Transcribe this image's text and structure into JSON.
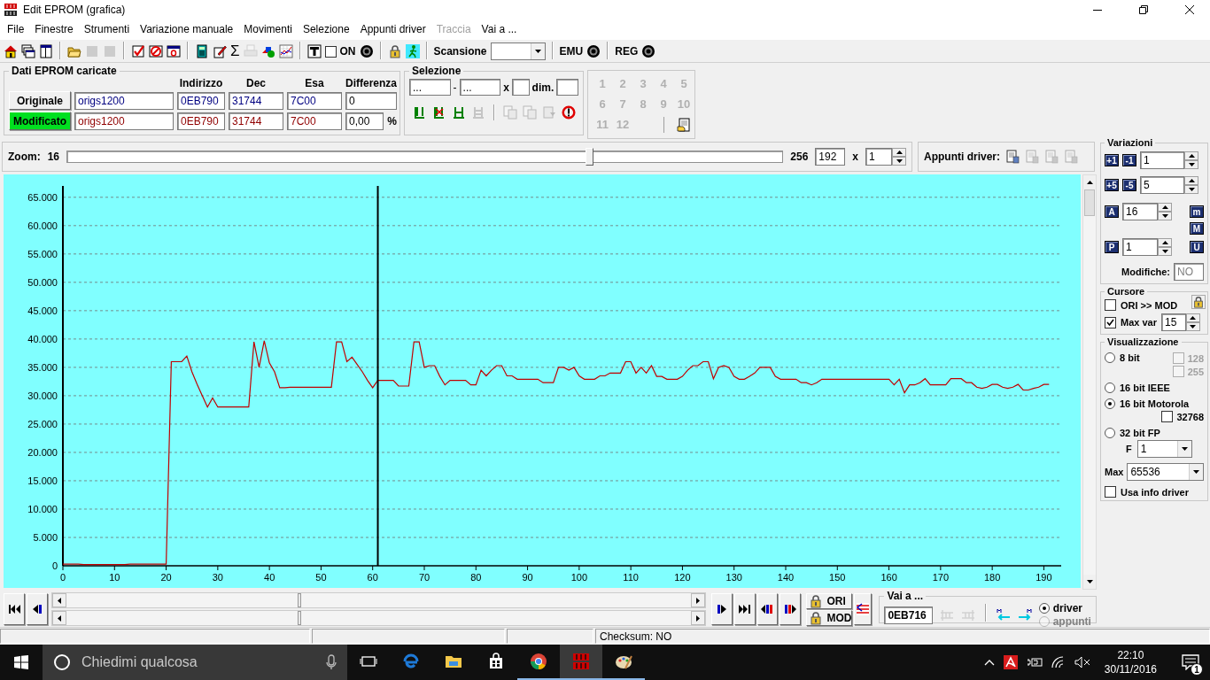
{
  "window": {
    "title": "Edit EPROM (grafica)"
  },
  "menu": [
    {
      "label": "File",
      "disabled": false
    },
    {
      "label": "Finestre",
      "disabled": false
    },
    {
      "label": "Strumenti",
      "disabled": false
    },
    {
      "label": "Variazione manuale",
      "disabled": false
    },
    {
      "label": "Movimenti",
      "disabled": false
    },
    {
      "label": "Selezione",
      "disabled": false
    },
    {
      "label": "Appunti driver",
      "disabled": false
    },
    {
      "label": "Traccia",
      "disabled": true
    },
    {
      "label": "Vai a ...",
      "disabled": false
    }
  ],
  "toolbar": [
    {
      "kind": "home",
      "disabled": false
    },
    {
      "kind": "windows",
      "disabled": false
    },
    {
      "kind": "panel",
      "disabled": false
    },
    {
      "kind": "sep"
    },
    {
      "kind": "folder",
      "disabled": false
    },
    {
      "kind": "square",
      "disabled": true
    },
    {
      "kind": "square",
      "disabled": true
    },
    {
      "kind": "sep"
    },
    {
      "kind": "check",
      "disabled": false
    },
    {
      "kind": "forbid",
      "disabled": false
    },
    {
      "kind": "zerowin",
      "disabled": false
    },
    {
      "kind": "sep"
    },
    {
      "kind": "calc",
      "disabled": false
    },
    {
      "kind": "edit",
      "disabled": false
    },
    {
      "kind": "glyph",
      "label": "Σ",
      "disabled": false
    },
    {
      "kind": "printer",
      "disabled": true
    },
    {
      "kind": "shapes",
      "disabled": false
    },
    {
      "kind": "graph",
      "disabled": false
    },
    {
      "kind": "sep"
    },
    {
      "kind": "tbox",
      "disabled": false
    },
    {
      "kind": "checkbox",
      "label": "ON",
      "checked": false
    },
    {
      "kind": "target",
      "disabled": false
    },
    {
      "kind": "sep"
    },
    {
      "kind": "lock",
      "disabled": false
    },
    {
      "kind": "runner",
      "disabled": false
    },
    {
      "kind": "sep"
    },
    {
      "kind": "combo",
      "label": "Scansione"
    },
    {
      "kind": "sep"
    },
    {
      "kind": "led",
      "label": "EMU"
    },
    {
      "kind": "sep"
    },
    {
      "kind": "led",
      "label": "REG"
    }
  ],
  "eprom": {
    "title": "Dati EPROM caricate",
    "columns": [
      "Indirizzo",
      "Dec",
      "Esa",
      "Differenza"
    ],
    "rows": [
      {
        "label": "Originale",
        "highlighted": false,
        "color": "#000080",
        "file": "origs1200",
        "address": "0EB790",
        "dec": "31744",
        "hex": "7C00",
        "difference": "0"
      },
      {
        "label": "Modificato",
        "highlighted": true,
        "color": "#900000",
        "file": "origs1200",
        "address": "0EB790",
        "dec": "31744",
        "hex": "7C00",
        "difference": "0,00",
        "unit": "%"
      }
    ]
  },
  "selection": {
    "title": "Selezione",
    "from": "...",
    "separator": "-",
    "to": "...",
    "times": "x",
    "dim_label": "dim.",
    "tools": [
      {
        "kind": "mstart",
        "disabled": false
      },
      {
        "kind": "mclear",
        "disabled": false
      },
      {
        "kind": "mboth",
        "disabled": false
      },
      {
        "kind": "mnone",
        "disabled": true
      },
      {
        "kind": "copy",
        "disabled": true
      },
      {
        "kind": "copy",
        "disabled": true
      },
      {
        "kind": "paste",
        "disabled": true
      },
      {
        "kind": "reset",
        "disabled": false
      }
    ]
  },
  "keys": {
    "buttons": [
      {
        "label": "1",
        "disabled": true
      },
      {
        "label": "2",
        "disabled": true
      },
      {
        "label": "3",
        "disabled": true
      },
      {
        "label": "4",
        "disabled": true
      },
      {
        "label": "5",
        "disabled": true
      },
      {
        "label": "6",
        "disabled": true
      },
      {
        "label": "7",
        "disabled": true
      },
      {
        "label": "8",
        "disabled": true
      },
      {
        "label": "9",
        "disabled": true
      },
      {
        "label": "10",
        "disabled": true
      },
      {
        "label": "11",
        "disabled": true
      },
      {
        "label": "12",
        "disabled": true
      }
    ],
    "clipboard": {
      "disabled": false
    }
  },
  "zoom": {
    "label": "Zoom:",
    "min": "16",
    "level": 0.733,
    "max": "256",
    "value": "192",
    "times": "x",
    "step": "1"
  },
  "driver_clipboard": {
    "label": "Appunti driver:",
    "tools": [
      {
        "disabled": false
      },
      {
        "disabled": true
      },
      {
        "disabled": true
      },
      {
        "disabled": true
      }
    ]
  },
  "chart": {
    "chart_data": {
      "type": "line",
      "xlim": [
        0,
        192.5
      ],
      "ylim": [
        0,
        67000
      ],
      "xticks": [
        0,
        10,
        20,
        30,
        40,
        50,
        60,
        70,
        80,
        90,
        100,
        110,
        120,
        130,
        140,
        150,
        160,
        170,
        180,
        190
      ],
      "yticks": [
        {
          "value": 0,
          "label": "0"
        },
        {
          "value": 5000,
          "label": "5.000"
        },
        {
          "value": 10000,
          "label": "10.000"
        },
        {
          "value": 15000,
          "label": "15.000"
        },
        {
          "value": 20000,
          "label": "20.000"
        },
        {
          "value": 25000,
          "label": "25.000"
        },
        {
          "value": 30000,
          "label": "30.000"
        },
        {
          "value": 35000,
          "label": "35.000"
        },
        {
          "value": 40000,
          "label": "40.000"
        },
        {
          "value": 45000,
          "label": "45.000"
        },
        {
          "value": 50000,
          "label": "50.000"
        },
        {
          "value": 55000,
          "label": "55.000"
        },
        {
          "value": 60000,
          "label": "60.000"
        },
        {
          "value": 65000,
          "label": "65.000"
        }
      ],
      "x": [
        0,
        1,
        2,
        3,
        4,
        5,
        6,
        7,
        8,
        9,
        10,
        11,
        12,
        13,
        14,
        15,
        16,
        17,
        18,
        19,
        20,
        21,
        22,
        23,
        24,
        25,
        26,
        27,
        28,
        29,
        30,
        31,
        32,
        33,
        34,
        35,
        36,
        37,
        38,
        39,
        40,
        41,
        42,
        43,
        44,
        45,
        46,
        47,
        48,
        49,
        50,
        51,
        52,
        53,
        54,
        55,
        56,
        57,
        58,
        59,
        60,
        61,
        62,
        63,
        64,
        65,
        66,
        67,
        68,
        69,
        70,
        71,
        72,
        73,
        74,
        75,
        76,
        77,
        78,
        79,
        80,
        81,
        82,
        83,
        84,
        85,
        86,
        87,
        88,
        89,
        90,
        91,
        92,
        93,
        94,
        95,
        96,
        97,
        98,
        99,
        100,
        101,
        102,
        103,
        104,
        105,
        106,
        107,
        108,
        109,
        110,
        111,
        112,
        113,
        114,
        115,
        116,
        117,
        118,
        119,
        120,
        121,
        122,
        123,
        124,
        125,
        126,
        127,
        128,
        129,
        130,
        131,
        132,
        133,
        134,
        135,
        136,
        137,
        138,
        139,
        140,
        141,
        142,
        143,
        144,
        145,
        146,
        147,
        148,
        149,
        150,
        151,
        152,
        153,
        154,
        155,
        156,
        157,
        158,
        159,
        160,
        161,
        162,
        163,
        164,
        165,
        166,
        167,
        168,
        169,
        170,
        171,
        172,
        173,
        174,
        175,
        176,
        177,
        178,
        179,
        180,
        181,
        182,
        183,
        184,
        185,
        186,
        187,
        188,
        189,
        190,
        191
      ],
      "series": [
        {
          "color": "#c00000",
          "values": [
            300,
            300,
            300,
            300,
            200,
            200,
            200,
            200,
            200,
            200,
            200,
            200,
            200,
            300,
            300,
            300,
            300,
            300,
            300,
            300,
            300,
            36000,
            36000,
            36000,
            37000,
            34200,
            32000,
            30000,
            28000,
            29600,
            28000,
            28000,
            28000,
            28000,
            28000,
            28000,
            28000,
            39500,
            35000,
            39700,
            35800,
            34200,
            31400,
            31400,
            31500,
            31500,
            31500,
            31500,
            31500,
            31500,
            31500,
            31500,
            31500,
            39500,
            39500,
            36000,
            36800,
            35500,
            34200,
            32700,
            31400,
            32700,
            32700,
            32700,
            32700,
            31700,
            31700,
            31700,
            39500,
            39500,
            35000,
            35300,
            35300,
            33400,
            31900,
            32700,
            32700,
            32700,
            32700,
            31900,
            31900,
            34500,
            33500,
            34500,
            35300,
            35300,
            33500,
            33500,
            32900,
            32900,
            32900,
            32900,
            32900,
            32300,
            32300,
            32300,
            35000,
            35000,
            34500,
            35000,
            33500,
            32900,
            32900,
            32900,
            33500,
            33500,
            34000,
            34000,
            34000,
            36000,
            36000,
            34000,
            35000,
            34000,
            35300,
            33400,
            33400,
            32900,
            32900,
            32900,
            33400,
            34500,
            35300,
            35300,
            36000,
            36000,
            33000,
            35000,
            35300,
            35000,
            33400,
            32900,
            32900,
            33400,
            34000,
            35000,
            35000,
            35000,
            33400,
            32900,
            32900,
            32900,
            32900,
            32300,
            32300,
            31900,
            32300,
            32900,
            32900,
            32900,
            32900,
            32900,
            32900,
            32900,
            32900,
            32900,
            32900,
            32900,
            32900,
            32900,
            32900,
            31900,
            32900,
            30500,
            31900,
            31900,
            32300,
            33000,
            31900,
            31900,
            31900,
            31900,
            33000,
            33000,
            33000,
            32300,
            32300,
            31500,
            31300,
            31500,
            32000,
            32000,
            31500,
            31300,
            31500,
            32000,
            31000,
            31000,
            31300,
            31500,
            32000,
            32000
          ]
        }
      ],
      "grid": true,
      "ref_lines": [
        {
          "axis": "x",
          "value": 61,
          "color": "#000000"
        }
      ]
    }
  },
  "variations": {
    "title": "Variazioni",
    "small_step": {
      "plus": "+1",
      "minus": "-1",
      "value": "1"
    },
    "big_step": {
      "plus": "+5",
      "minus": "-5",
      "value": "5"
    },
    "a": {
      "key": "A",
      "value": "16"
    },
    "p": {
      "key": "P",
      "value": "1"
    },
    "side_keys": [
      "m",
      "M",
      "U"
    ],
    "changes_label": "Modifiche:",
    "changes": "NO"
  },
  "cursor": {
    "title": "Cursore",
    "options": [
      {
        "label": "ORI >> MOD",
        "checked": false
      },
      {
        "label": "Max var",
        "checked": true,
        "value": "15"
      }
    ]
  },
  "display": {
    "title": "Visualizzazione",
    "modes": [
      {
        "label": "8 bit",
        "selected": false,
        "options": [
          {
            "label": "128",
            "checked": false,
            "disabled": true
          },
          {
            "label": "255",
            "checked": false,
            "disabled": true
          }
        ]
      },
      {
        "label": "16 bit IEEE",
        "selected": false
      },
      {
        "label": "16 bit Motorola",
        "selected": true,
        "options": [
          {
            "label": "32768",
            "checked": false,
            "disabled": false
          }
        ]
      },
      {
        "label": "32 bit FP",
        "selected": false,
        "select": {
          "label": "F",
          "value": "1"
        }
      }
    ],
    "max": {
      "label": "Max",
      "value": "65536"
    },
    "use_driver": {
      "label": "Usa info driver",
      "checked": false
    }
  },
  "navigation": {
    "left": [
      {
        "kind": "first"
      },
      {
        "kind": "prev"
      }
    ],
    "right": [
      {
        "kind": "next"
      },
      {
        "kind": "last"
      },
      {
        "kind": "prevred"
      },
      {
        "kind": "nextred"
      }
    ],
    "locks": [
      "ORI",
      "MOD"
    ],
    "goto": {
      "title": "Vai a ...",
      "value": "0EB716",
      "targets": [
        {
          "label": "driver",
          "selected": true,
          "disabled": false
        },
        {
          "label": "appunti",
          "selected": false,
          "disabled": true
        }
      ]
    }
  },
  "status_bar": {
    "checksum": "Checksum: NO"
  },
  "taskbar": {
    "search": {
      "placeholder": "Chiedimi qualcosa"
    },
    "apps": [
      {
        "kind": "taskview",
        "active": false,
        "running": false
      },
      {
        "kind": "edge",
        "active": false,
        "running": false
      },
      {
        "kind": "explorer",
        "active": false,
        "running": false
      },
      {
        "kind": "store",
        "active": false,
        "running": false
      },
      {
        "kind": "chrome",
        "active": false,
        "running": true
      },
      {
        "kind": "ecm",
        "active": true,
        "running": true
      },
      {
        "kind": "paint",
        "active": false,
        "running": true
      }
    ],
    "time": "22:10",
    "date": "30/11/2016",
    "notifications": "1"
  }
}
